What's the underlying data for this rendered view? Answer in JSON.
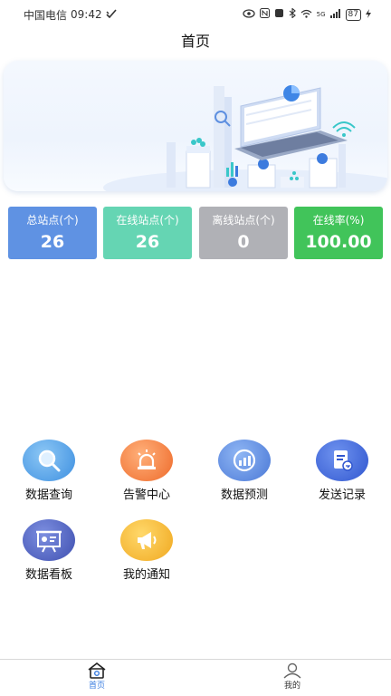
{
  "status_bar": {
    "carrier": "中国电信",
    "time": "09:42",
    "network": "5G",
    "battery": "87"
  },
  "header": {
    "title": "首页"
  },
  "stats": [
    {
      "label": "总站点(个)",
      "value": "26",
      "color": "#5f92e3"
    },
    {
      "label": "在线站点(个)",
      "value": "26",
      "color": "#65d5b3"
    },
    {
      "label": "离线站点(个)",
      "value": "0",
      "color": "#b0b1b6"
    },
    {
      "label": "在线率(%)",
      "value": "100.00",
      "color": "#41c45a"
    }
  ],
  "menu": [
    {
      "label": "数据查询",
      "icon": "magnifier-icon"
    },
    {
      "label": "告警中心",
      "icon": "alarm-light-icon"
    },
    {
      "label": "数据预测",
      "icon": "chart-gauge-icon"
    },
    {
      "label": "发送记录",
      "icon": "document-send-icon"
    },
    {
      "label": "数据看板",
      "icon": "dashboard-board-icon"
    },
    {
      "label": "我的通知",
      "icon": "megaphone-icon"
    }
  ],
  "tabbar": {
    "home_label": "首页",
    "mine_label": "我的",
    "active_color": "#3a7de0"
  }
}
